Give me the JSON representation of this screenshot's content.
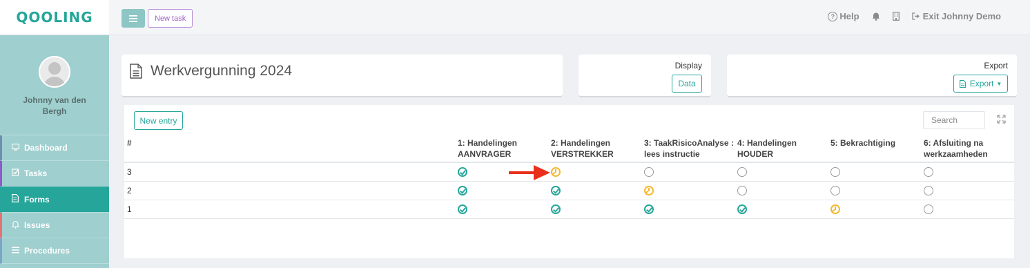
{
  "brand": {
    "logo_text": "QOOLING",
    "accent": "#26a69a"
  },
  "sidebar": {
    "user_name": "Johnny van den Bergh",
    "items": [
      {
        "label": "Dashboard",
        "icon": "monitor-icon"
      },
      {
        "label": "Tasks",
        "icon": "checkbox-icon"
      },
      {
        "label": "Forms",
        "icon": "document-icon",
        "active": true
      },
      {
        "label": "Issues",
        "icon": "bell-icon"
      },
      {
        "label": "Procedures",
        "icon": "list-icon"
      }
    ]
  },
  "topbar": {
    "menu_icon": "hamburger-icon",
    "new_task_label": "New task",
    "help_label": "Help",
    "exit_label": "Exit Johnny Demo"
  },
  "page": {
    "title": "Werkvergunning 2024",
    "display_label": "Display",
    "data_button": "Data",
    "export_label": "Export",
    "export_button": "Export",
    "new_entry_button": "New entry",
    "search_placeholder": "Search"
  },
  "table": {
    "columns": [
      "#",
      "1: Handelingen AANVRAGER",
      "2: Handelingen VERSTREKKER",
      "3: TaakRisicoAnalyse : lees instructie",
      "4: Handelingen HOUDER",
      "5: Bekrachtiging",
      "6: Afsluiting na werkzaamheden"
    ],
    "rows": [
      {
        "id": "3",
        "statuses": [
          "done",
          "pending",
          "empty",
          "empty",
          "empty",
          "empty"
        ]
      },
      {
        "id": "2",
        "statuses": [
          "done",
          "done",
          "pending",
          "empty",
          "empty",
          "empty"
        ]
      },
      {
        "id": "1",
        "statuses": [
          "done",
          "done",
          "done",
          "done",
          "pending",
          "empty"
        ]
      }
    ],
    "status_colors": {
      "done": "#26a69a",
      "pending": "#f5b92f",
      "empty": "#9a9a9a"
    }
  },
  "annotation": {
    "arrow_color": "#e8301c"
  }
}
